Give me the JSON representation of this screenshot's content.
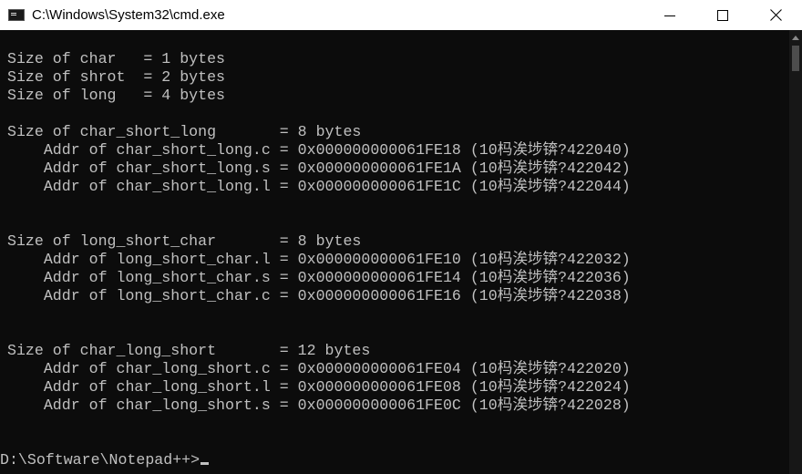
{
  "window": {
    "title": "C:\\Windows\\System32\\cmd.exe"
  },
  "console": {
    "lines": [
      "",
      "Size of char   = 1 bytes",
      "Size of shrot  = 2 bytes",
      "Size of long   = 4 bytes",
      "",
      "Size of char_short_long       = 8 bytes",
      "    Addr of char_short_long.c = 0x000000000061FE18 (10杩涘埗锛?422040)",
      "    Addr of char_short_long.s = 0x000000000061FE1A (10杩涘埗锛?422042)",
      "    Addr of char_short_long.l = 0x000000000061FE1C (10杩涘埗锛?422044)",
      "",
      "",
      "Size of long_short_char       = 8 bytes",
      "    Addr of long_short_char.l = 0x000000000061FE10 (10杩涘埗锛?422032)",
      "    Addr of long_short_char.s = 0x000000000061FE14 (10杩涘埗锛?422036)",
      "    Addr of long_short_char.c = 0x000000000061FE16 (10杩涘埗锛?422038)",
      "",
      "",
      "Size of char_long_short       = 12 bytes",
      "    Addr of char_long_short.c = 0x000000000061FE04 (10杩涘埗锛?422020)",
      "    Addr of char_long_short.l = 0x000000000061FE08 (10杩涘埗锛?422024)",
      "    Addr of char_long_short.s = 0x000000000061FE0C (10杩涘埗锛?422028)",
      "",
      ""
    ],
    "prompt": "D:\\Software\\Notepad++>"
  },
  "icons": {
    "app": "cmd-app-icon",
    "minimize": "minimize-icon",
    "maximize": "maximize-icon",
    "close": "close-icon",
    "scroll_up": "scroll-up-arrow-icon"
  },
  "colors": {
    "background": "#0c0c0c",
    "text": "#c0c0c0",
    "titlebar": "#ffffff"
  }
}
